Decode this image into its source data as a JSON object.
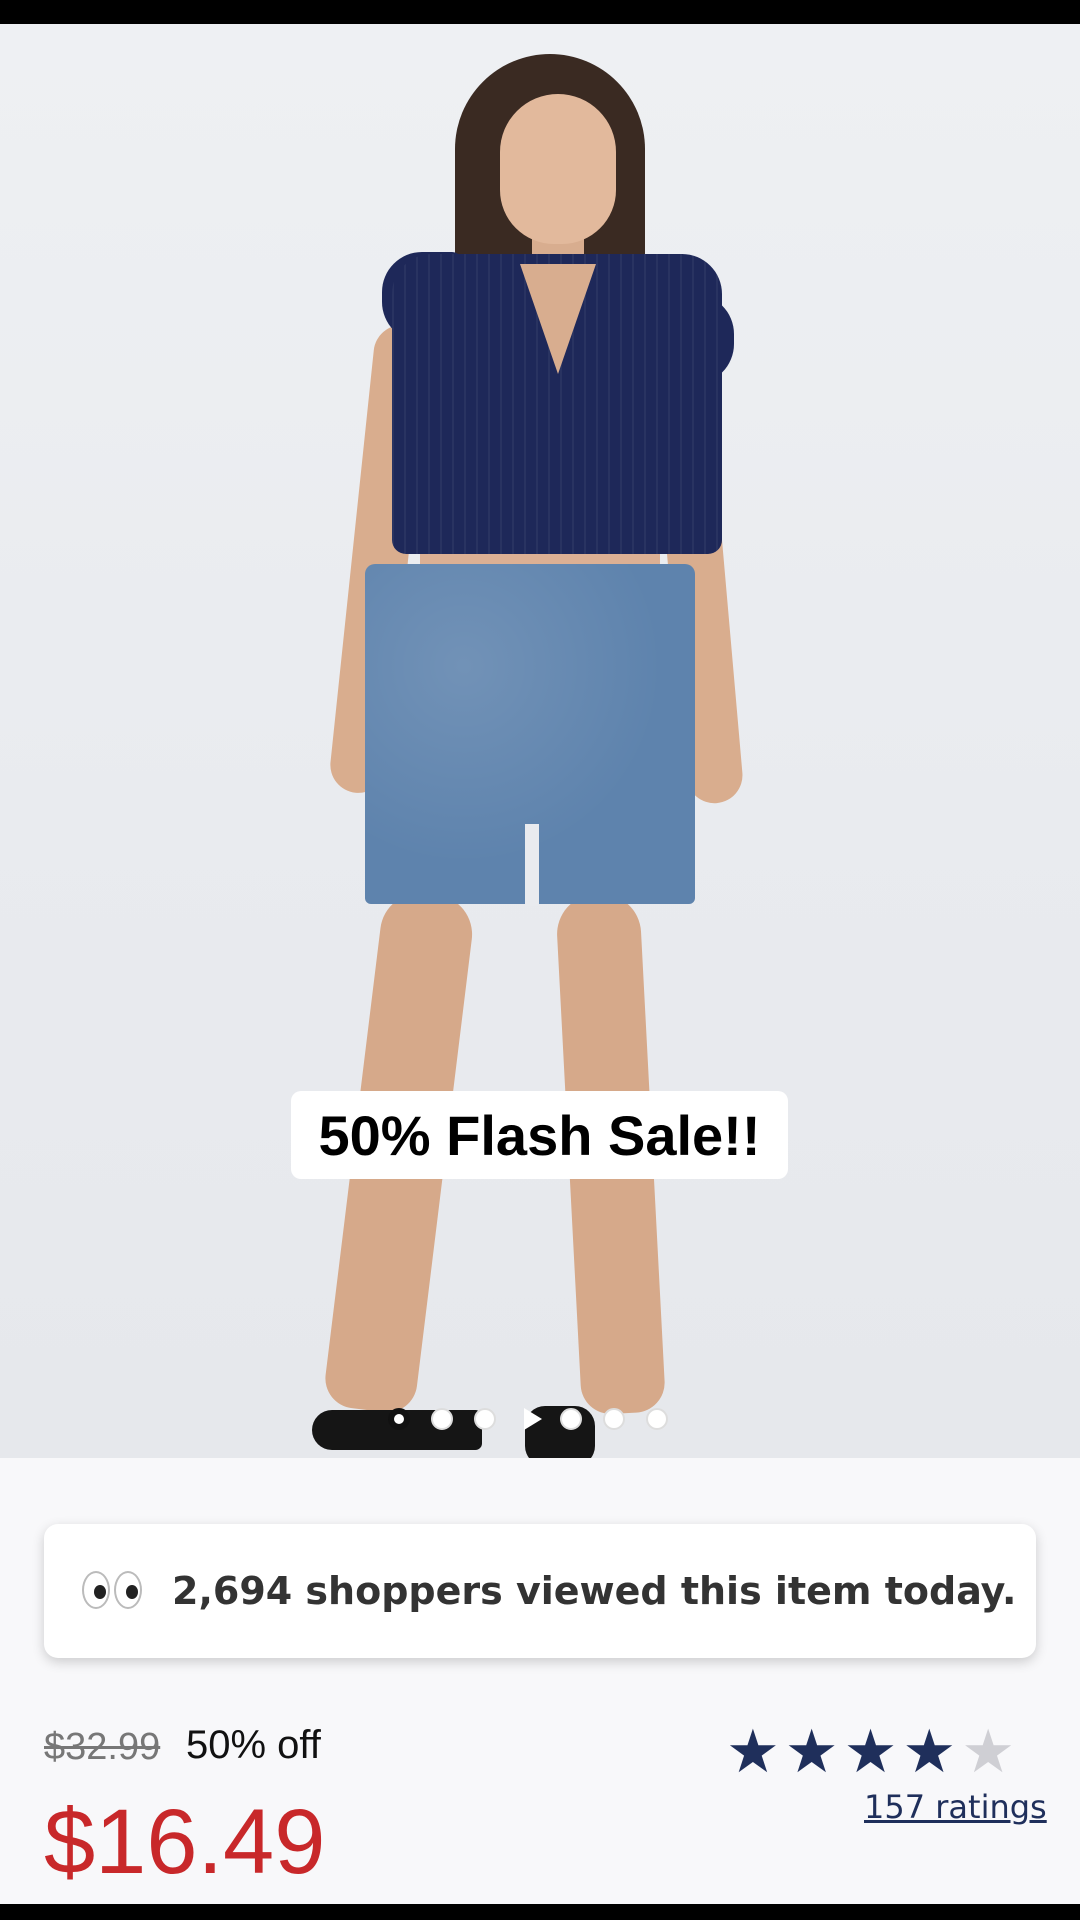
{
  "hero": {
    "badge_text": "50% Flash Sale!!",
    "carousel": {
      "total_dots": 7,
      "active_index": 0
    }
  },
  "social_proof": {
    "icon": "eyes-icon",
    "text": "2,694 shoppers viewed this item today."
  },
  "pricing": {
    "original_price": "$32.99",
    "discount_label": "50% off",
    "sale_price": "$16.49",
    "sale_color": "#c8282a"
  },
  "rating": {
    "stars_filled": 4,
    "stars_total": 5,
    "star_color": "#1f2f5b",
    "ratings_link": "157 ratings"
  }
}
